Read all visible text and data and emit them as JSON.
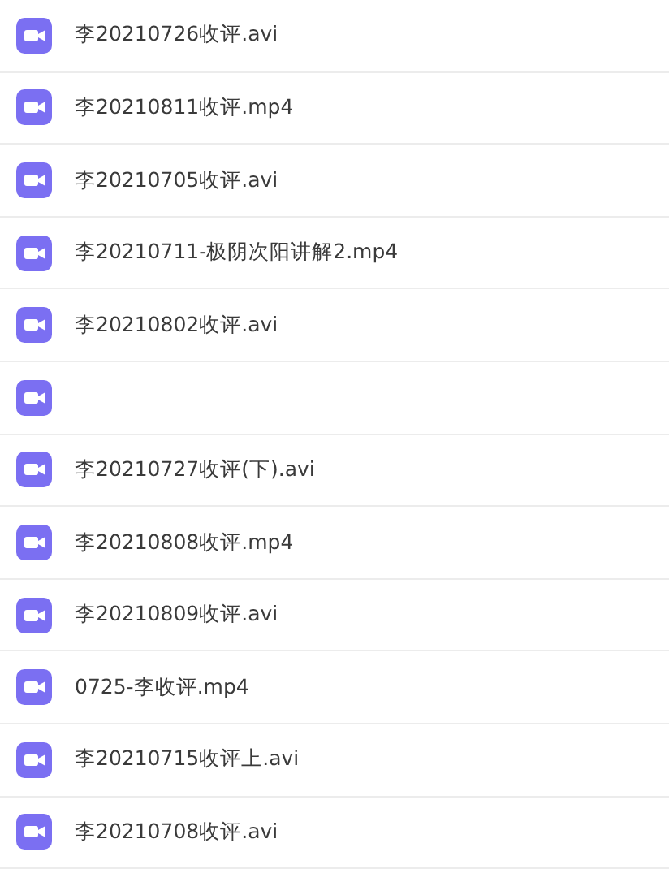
{
  "files": [
    {
      "kind": "file",
      "name": "李20210726收评.avi"
    },
    {
      "kind": "file",
      "name": "李20210811收评.mp4"
    },
    {
      "kind": "file",
      "name": "李20210705收评.avi"
    },
    {
      "kind": "file",
      "name": "李20210711-极阴次阳讲解2.mp4"
    },
    {
      "kind": "file",
      "name": "李20210802收评.avi"
    },
    {
      "kind": "obscured"
    },
    {
      "kind": "file",
      "name": "李20210727收评(下).avi"
    },
    {
      "kind": "file",
      "name": "李20210808收评.mp4"
    },
    {
      "kind": "file",
      "name": "李20210809收评.avi"
    },
    {
      "kind": "file",
      "name": "0725-李收评.mp4"
    },
    {
      "kind": "file",
      "name": "李20210715收评上.avi"
    },
    {
      "kind": "file",
      "name": "李20210708收评.avi"
    }
  ]
}
